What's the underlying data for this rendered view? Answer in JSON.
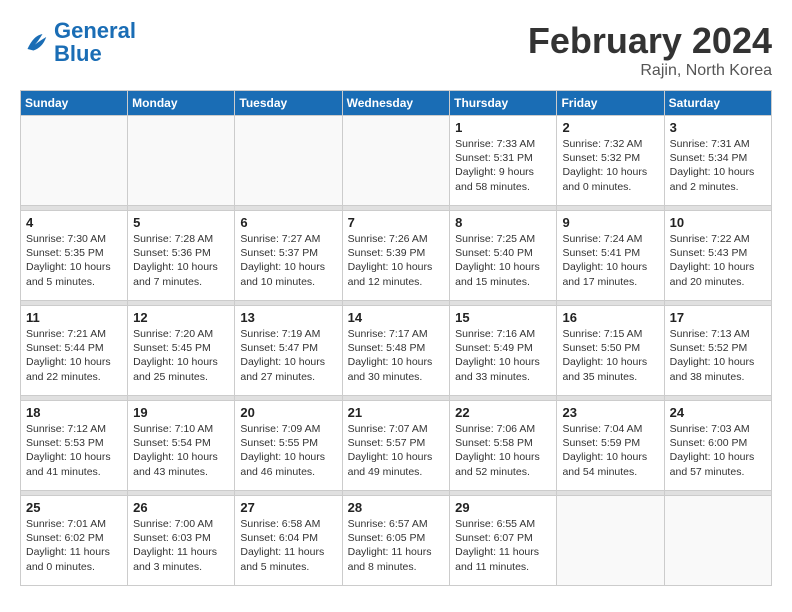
{
  "header": {
    "logo_general": "General",
    "logo_blue": "Blue",
    "month_title": "February 2024",
    "location": "Rajin, North Korea"
  },
  "days_of_week": [
    "Sunday",
    "Monday",
    "Tuesday",
    "Wednesday",
    "Thursday",
    "Friday",
    "Saturday"
  ],
  "weeks": [
    [
      {
        "day": "",
        "detail": ""
      },
      {
        "day": "",
        "detail": ""
      },
      {
        "day": "",
        "detail": ""
      },
      {
        "day": "",
        "detail": ""
      },
      {
        "day": "1",
        "detail": "Sunrise: 7:33 AM\nSunset: 5:31 PM\nDaylight: 9 hours\nand 58 minutes."
      },
      {
        "day": "2",
        "detail": "Sunrise: 7:32 AM\nSunset: 5:32 PM\nDaylight: 10 hours\nand 0 minutes."
      },
      {
        "day": "3",
        "detail": "Sunrise: 7:31 AM\nSunset: 5:34 PM\nDaylight: 10 hours\nand 2 minutes."
      }
    ],
    [
      {
        "day": "4",
        "detail": "Sunrise: 7:30 AM\nSunset: 5:35 PM\nDaylight: 10 hours\nand 5 minutes."
      },
      {
        "day": "5",
        "detail": "Sunrise: 7:28 AM\nSunset: 5:36 PM\nDaylight: 10 hours\nand 7 minutes."
      },
      {
        "day": "6",
        "detail": "Sunrise: 7:27 AM\nSunset: 5:37 PM\nDaylight: 10 hours\nand 10 minutes."
      },
      {
        "day": "7",
        "detail": "Sunrise: 7:26 AM\nSunset: 5:39 PM\nDaylight: 10 hours\nand 12 minutes."
      },
      {
        "day": "8",
        "detail": "Sunrise: 7:25 AM\nSunset: 5:40 PM\nDaylight: 10 hours\nand 15 minutes."
      },
      {
        "day": "9",
        "detail": "Sunrise: 7:24 AM\nSunset: 5:41 PM\nDaylight: 10 hours\nand 17 minutes."
      },
      {
        "day": "10",
        "detail": "Sunrise: 7:22 AM\nSunset: 5:43 PM\nDaylight: 10 hours\nand 20 minutes."
      }
    ],
    [
      {
        "day": "11",
        "detail": "Sunrise: 7:21 AM\nSunset: 5:44 PM\nDaylight: 10 hours\nand 22 minutes."
      },
      {
        "day": "12",
        "detail": "Sunrise: 7:20 AM\nSunset: 5:45 PM\nDaylight: 10 hours\nand 25 minutes."
      },
      {
        "day": "13",
        "detail": "Sunrise: 7:19 AM\nSunset: 5:47 PM\nDaylight: 10 hours\nand 27 minutes."
      },
      {
        "day": "14",
        "detail": "Sunrise: 7:17 AM\nSunset: 5:48 PM\nDaylight: 10 hours\nand 30 minutes."
      },
      {
        "day": "15",
        "detail": "Sunrise: 7:16 AM\nSunset: 5:49 PM\nDaylight: 10 hours\nand 33 minutes."
      },
      {
        "day": "16",
        "detail": "Sunrise: 7:15 AM\nSunset: 5:50 PM\nDaylight: 10 hours\nand 35 minutes."
      },
      {
        "day": "17",
        "detail": "Sunrise: 7:13 AM\nSunset: 5:52 PM\nDaylight: 10 hours\nand 38 minutes."
      }
    ],
    [
      {
        "day": "18",
        "detail": "Sunrise: 7:12 AM\nSunset: 5:53 PM\nDaylight: 10 hours\nand 41 minutes."
      },
      {
        "day": "19",
        "detail": "Sunrise: 7:10 AM\nSunset: 5:54 PM\nDaylight: 10 hours\nand 43 minutes."
      },
      {
        "day": "20",
        "detail": "Sunrise: 7:09 AM\nSunset: 5:55 PM\nDaylight: 10 hours\nand 46 minutes."
      },
      {
        "day": "21",
        "detail": "Sunrise: 7:07 AM\nSunset: 5:57 PM\nDaylight: 10 hours\nand 49 minutes."
      },
      {
        "day": "22",
        "detail": "Sunrise: 7:06 AM\nSunset: 5:58 PM\nDaylight: 10 hours\nand 52 minutes."
      },
      {
        "day": "23",
        "detail": "Sunrise: 7:04 AM\nSunset: 5:59 PM\nDaylight: 10 hours\nand 54 minutes."
      },
      {
        "day": "24",
        "detail": "Sunrise: 7:03 AM\nSunset: 6:00 PM\nDaylight: 10 hours\nand 57 minutes."
      }
    ],
    [
      {
        "day": "25",
        "detail": "Sunrise: 7:01 AM\nSunset: 6:02 PM\nDaylight: 11 hours\nand 0 minutes."
      },
      {
        "day": "26",
        "detail": "Sunrise: 7:00 AM\nSunset: 6:03 PM\nDaylight: 11 hours\nand 3 minutes."
      },
      {
        "day": "27",
        "detail": "Sunrise: 6:58 AM\nSunset: 6:04 PM\nDaylight: 11 hours\nand 5 minutes."
      },
      {
        "day": "28",
        "detail": "Sunrise: 6:57 AM\nSunset: 6:05 PM\nDaylight: 11 hours\nand 8 minutes."
      },
      {
        "day": "29",
        "detail": "Sunrise: 6:55 AM\nSunset: 6:07 PM\nDaylight: 11 hours\nand 11 minutes."
      },
      {
        "day": "",
        "detail": ""
      },
      {
        "day": "",
        "detail": ""
      }
    ]
  ]
}
